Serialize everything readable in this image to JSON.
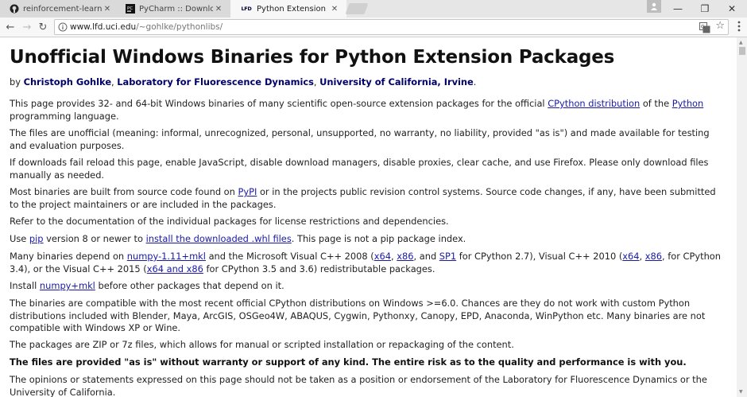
{
  "tabs": [
    {
      "label": "reinforcement-learning/",
      "icon": "github-icon",
      "close": "✕"
    },
    {
      "label": "PyCharm :: Download La",
      "icon": "pycharm-icon",
      "close": "✕"
    },
    {
      "label": "Python Extension Packa",
      "icon": "lfd-icon",
      "favicon_text": "LFD",
      "close": "✕"
    }
  ],
  "window_controls": {
    "minimize": "—",
    "maximize": "❐",
    "close": "✕"
  },
  "toolbar": {
    "back": "←",
    "forward": "→",
    "reload": "↻",
    "url_host": "www.lfd.uci.edu",
    "url_path": "/~gohlke/pythonlibs/",
    "star": "☆"
  },
  "page": {
    "title": "Unofficial Windows Binaries for Python Extension Packages",
    "byline": {
      "prefix": "by ",
      "author": "Christoph Gohlke",
      "sep1": ", ",
      "lab": "Laboratory for Fluorescence Dynamics",
      "sep2": ", ",
      "university": "University of California, Irvine",
      "end": "."
    },
    "p1": {
      "a": "This page provides 32- and 64-bit Windows binaries of many scientific open-source extension packages for the official ",
      "link1": "CPython distribution",
      "b": " of the ",
      "link2": "Python",
      "c": " programming language."
    },
    "p2": "The files are unofficial (meaning: informal, unrecognized, personal, unsupported, no warranty, no liability, provided \"as is\") and made available for testing and evaluation purposes.",
    "p3": "If downloads fail reload this page, enable JavaScript, disable download managers, disable proxies, clear cache, and use Firefox. Please only download files manually as needed.",
    "p4": {
      "a": "Most binaries are built from source code found on ",
      "link": "PyPI",
      "b": " or in the projects public revision control systems. Source code changes, if any, have been submitted to the project maintainers or are included in the packages."
    },
    "p5": "Refer to the documentation of the individual packages for license restrictions and dependencies.",
    "p6": {
      "a": "Use ",
      "link1": "pip",
      "b": " version 8 or newer to ",
      "link2": "install the downloaded .whl files",
      "c": ". This page is not a pip package index."
    },
    "p7": {
      "a": "Many binaries depend on ",
      "link1": "numpy-1.11+mkl",
      "b": " and the Microsoft Visual C++ 2008 (",
      "link2": "x64",
      "c": ", ",
      "link3": "x86",
      "d": ", and ",
      "link4": "SP1",
      "e": " for CPython 2.7), Visual C++ 2010 (",
      "link5": "x64",
      "f": ", ",
      "link6": "x86",
      "g": ", for CPython 3.4), or the Visual C++ 2015 (",
      "link7": "x64 and x86",
      "h": " for CPython 3.5 and 3.6) redistributable packages."
    },
    "p8": {
      "a": "Install ",
      "link": "numpy+mkl",
      "b": " before other packages that depend on it."
    },
    "p9": "The binaries are compatible with the most recent official CPython distributions on Windows >=6.0. Chances are they do not work with custom Python distributions included with Blender, Maya, ArcGIS, OSGeo4W, ABAQUS, Cygwin, Pythonxy, Canopy, EPD, Anaconda, WinPython etc. Many binaries are not compatible with Windows XP or Wine.",
    "p10": "The packages are ZIP or 7z files, which allows for manual or scripted installation or repackaging of the content.",
    "p11": "The files are provided \"as is\" without warranty or support of any kind. The entire risk as to the quality and performance is with you.",
    "p12": "The opinions or statements expressed on this page should not be taken as a position or endorsement of the Laboratory for Fluorescence Dynamics or the University of California."
  }
}
